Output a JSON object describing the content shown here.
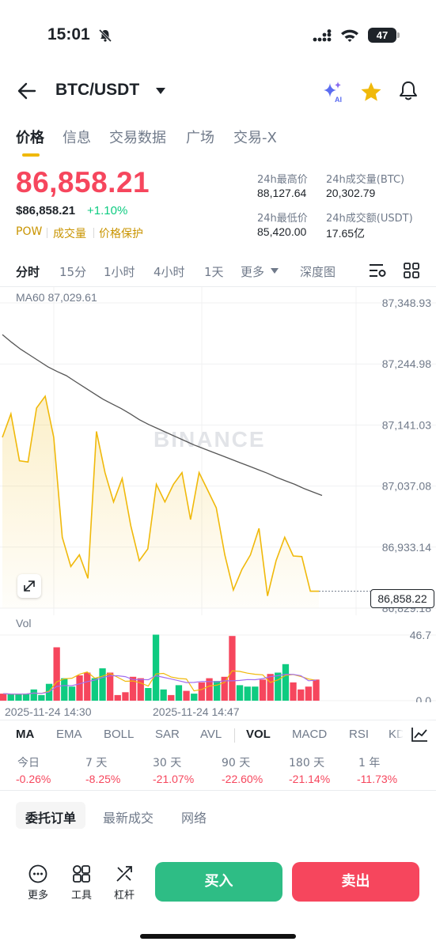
{
  "status_bar": {
    "time": "15:01",
    "battery": "47"
  },
  "header": {
    "pair": "BTC/USDT"
  },
  "tabs": [
    {
      "label": "价格",
      "active": true
    },
    {
      "label": "信息",
      "active": false
    },
    {
      "label": "交易数据",
      "active": false
    },
    {
      "label": "广场",
      "active": false
    },
    {
      "label": "交易-X",
      "active": false
    }
  ],
  "price": {
    "last": "86,858.21",
    "usd": "$86,858.21",
    "change": "+1.10%"
  },
  "tags": [
    "POW",
    "成交量",
    "价格保护"
  ],
  "stats": {
    "high_label": "24h最高价",
    "high": "88,127.64",
    "vol_btc_label": "24h成交量(BTC)",
    "vol_btc": "20,302.79",
    "low_label": "24h最低价",
    "low": "85,420.00",
    "vol_usdt_label": "24h成交额(USDT)",
    "vol_usdt": "17.65亿"
  },
  "intervals": [
    {
      "label": "分时",
      "active": true
    },
    {
      "label": "15分",
      "active": false
    },
    {
      "label": "1小时",
      "active": false
    },
    {
      "label": "4小时",
      "active": false
    },
    {
      "label": "1天",
      "active": false
    },
    {
      "label": "更多",
      "active": false
    },
    {
      "label": "深度图",
      "active": false
    }
  ],
  "colors": {
    "up": "#0ecb81",
    "down": "#f6465d",
    "accent": "#f0b90b",
    "ma": "#555555"
  },
  "chart_data": {
    "type": "line",
    "ma_label": "MA60",
    "ma_value": "87,029.61",
    "y_ticks": [
      "87,348.93",
      "87,244.98",
      "87,141.03",
      "87,037.08",
      "86,933.14",
      "86,829.18"
    ],
    "ylim": [
      86829.18,
      87348.93
    ],
    "last_price_label": "86,858.22",
    "price": [
      87120,
      87160,
      87080,
      87078,
      87170,
      87190,
      87120,
      86950,
      86900,
      86920,
      86880,
      87130,
      87060,
      87010,
      87050,
      86970,
      86910,
      86930,
      87040,
      87010,
      87040,
      87060,
      86980,
      87060,
      87030,
      87000,
      86920,
      86860,
      86895,
      86920,
      86965,
      86850,
      86910,
      86950,
      86918,
      86917,
      86858,
      86858
    ],
    "ma60": [
      87295,
      87282,
      87270,
      87260,
      87250,
      87240,
      87232,
      87225,
      87215,
      87205,
      87195,
      87185,
      87177,
      87169,
      87160,
      87150,
      87142,
      87135,
      87128,
      87121,
      87114,
      87107,
      87101,
      87095,
      87089,
      87083,
      87077,
      87071,
      87065,
      87059,
      87052,
      87046,
      87040,
      87033,
      87027,
      87021
    ],
    "watermark": "BINANCE",
    "vol_label": "Vol",
    "vol_ticks": [
      "46.7",
      "0.0"
    ],
    "volume": [
      {
        "v": 5,
        "up": false
      },
      {
        "v": 4.5,
        "up": true
      },
      {
        "v": 4.5,
        "up": true
      },
      {
        "v": 5,
        "up": true
      },
      {
        "v": 8,
        "up": true
      },
      {
        "v": 4,
        "up": true
      },
      {
        "v": 12,
        "up": true
      },
      {
        "v": 38,
        "up": false
      },
      {
        "v": 16,
        "up": true
      },
      {
        "v": 10,
        "up": true
      },
      {
        "v": 18,
        "up": false
      },
      {
        "v": 20,
        "up": false
      },
      {
        "v": 16,
        "up": true
      },
      {
        "v": 23,
        "up": true
      },
      {
        "v": 20,
        "up": false
      },
      {
        "v": 4,
        "up": false
      },
      {
        "v": 6,
        "up": false
      },
      {
        "v": 17,
        "up": false
      },
      {
        "v": 16,
        "up": false
      },
      {
        "v": 9,
        "up": true
      },
      {
        "v": 47,
        "up": true
      },
      {
        "v": 8,
        "up": true
      },
      {
        "v": 4,
        "up": false
      },
      {
        "v": 11,
        "up": true
      },
      {
        "v": 7,
        "up": false
      },
      {
        "v": 5,
        "up": true
      },
      {
        "v": 13,
        "up": false
      },
      {
        "v": 16,
        "up": false
      },
      {
        "v": 14,
        "up": true
      },
      {
        "v": 17,
        "up": false
      },
      {
        "v": 46,
        "up": false
      },
      {
        "v": 11,
        "up": true
      },
      {
        "v": 10,
        "up": true
      },
      {
        "v": 10,
        "up": true
      },
      {
        "v": 15,
        "up": false
      },
      {
        "v": 19,
        "up": false
      },
      {
        "v": 20,
        "up": true
      },
      {
        "v": 26,
        "up": true
      },
      {
        "v": 13,
        "up": false
      },
      {
        "v": 8,
        "up": false
      },
      {
        "v": 10,
        "up": false
      },
      {
        "v": 15,
        "up": false
      }
    ],
    "x_ticks": [
      "2025-11-24 14:30",
      "2025-11-24 14:47"
    ]
  },
  "indicators": [
    {
      "label": "MA",
      "active": true
    },
    {
      "label": "EMA",
      "active": false
    },
    {
      "label": "BOLL",
      "active": false
    },
    {
      "label": "SAR",
      "active": false
    },
    {
      "label": "AVL",
      "active": false
    },
    {
      "label": "VOL",
      "active": true
    },
    {
      "label": "MACD",
      "active": false
    },
    {
      "label": "RSI",
      "active": false
    },
    {
      "label": "KD",
      "active": false
    }
  ],
  "performance": [
    {
      "label": "今日",
      "value": "-0.26%"
    },
    {
      "label": "7 天",
      "value": "-8.25%"
    },
    {
      "label": "30 天",
      "value": "-21.07%"
    },
    {
      "label": "90 天",
      "value": "-22.60%"
    },
    {
      "label": "180 天",
      "value": "-21.14%"
    },
    {
      "label": "1 年",
      "value": "-11.73%"
    }
  ],
  "order_tabs": [
    "委托订单",
    "最新成交",
    "网络"
  ],
  "bottom": {
    "more": "更多",
    "tools": "工具",
    "leverage": "杠杆",
    "buy": "买入",
    "sell": "卖出"
  }
}
